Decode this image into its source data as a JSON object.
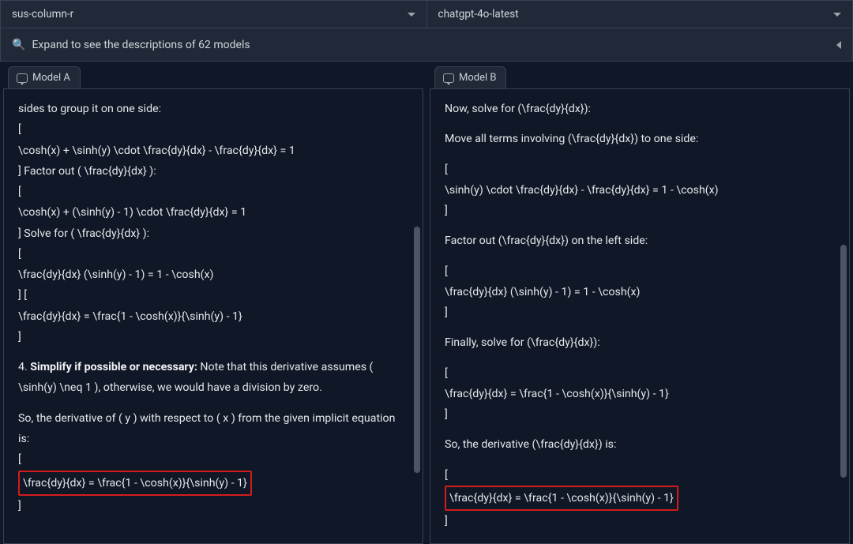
{
  "selectors": {
    "left": "sus-column-r",
    "right": "chatgpt-4o-latest"
  },
  "expand": {
    "icon": "🔍",
    "text": "Expand to see the descriptions of 62 models"
  },
  "panelA": {
    "tab": "Model A",
    "lines": {
      "l1": "sides to group it on one side:",
      "l2": "[",
      "l3": "\\cosh(x) + \\sinh(y) \\cdot \\frac{dy}{dx} - \\frac{dy}{dx} = 1",
      "l4": "] Factor out ( \\frac{dy}{dx} ):",
      "l5": "[",
      "l6": "\\cosh(x) + (\\sinh(y) - 1) \\cdot \\frac{dy}{dx} = 1",
      "l7": "] Solve for ( \\frac{dy}{dx} ):",
      "l8": "[",
      "l9": "\\frac{dy}{dx} (\\sinh(y) - 1) = 1 - \\cosh(x)",
      "l10": "] [",
      "l11": "\\frac{dy}{dx} = \\frac{1 - \\cosh(x)}{\\sinh(y) - 1}",
      "l12": "]",
      "step4_num": "4. ",
      "step4_bold": "Simplify if possible or necessary:",
      "step4_rest": " Note that this derivative assumes ( \\sinh(y) \\neq 1 ), otherwise, we would have a division by zero.",
      "so": "So, the derivative of ( y ) with respect to ( x ) from the given implicit equation is:",
      "fa": "[",
      "fb": "\\frac{dy}{dx} = \\frac{1 - \\cosh(x)}{\\sinh(y) - 1}",
      "fc": "]"
    }
  },
  "panelB": {
    "tab": "Model B",
    "lines": {
      "l1": "Now, solve for (\\frac{dy}{dx}):",
      "l2": "Move all terms involving (\\frac{dy}{dx}) to one side:",
      "l3": "[",
      "l4": "\\sinh(y) \\cdot \\frac{dy}{dx} - \\frac{dy}{dx} = 1 - \\cosh(x)",
      "l5": "]",
      "l6": "Factor out (\\frac{dy}{dx}) on the left side:",
      "l7": "[",
      "l8": "\\frac{dy}{dx} (\\sinh(y) - 1) = 1 - \\cosh(x)",
      "l9": "]",
      "l10": "Finally, solve for (\\frac{dy}{dx}):",
      "l11": "[",
      "l12": "\\frac{dy}{dx} = \\frac{1 - \\cosh(x)}{\\sinh(y) - 1}",
      "l13": "]",
      "so": "So, the derivative (\\frac{dy}{dx}) is:",
      "fa": "[",
      "fb": "\\frac{dy}{dx} = \\frac{1 - \\cosh(x)}{\\sinh(y) - 1}",
      "fc": "]"
    }
  }
}
